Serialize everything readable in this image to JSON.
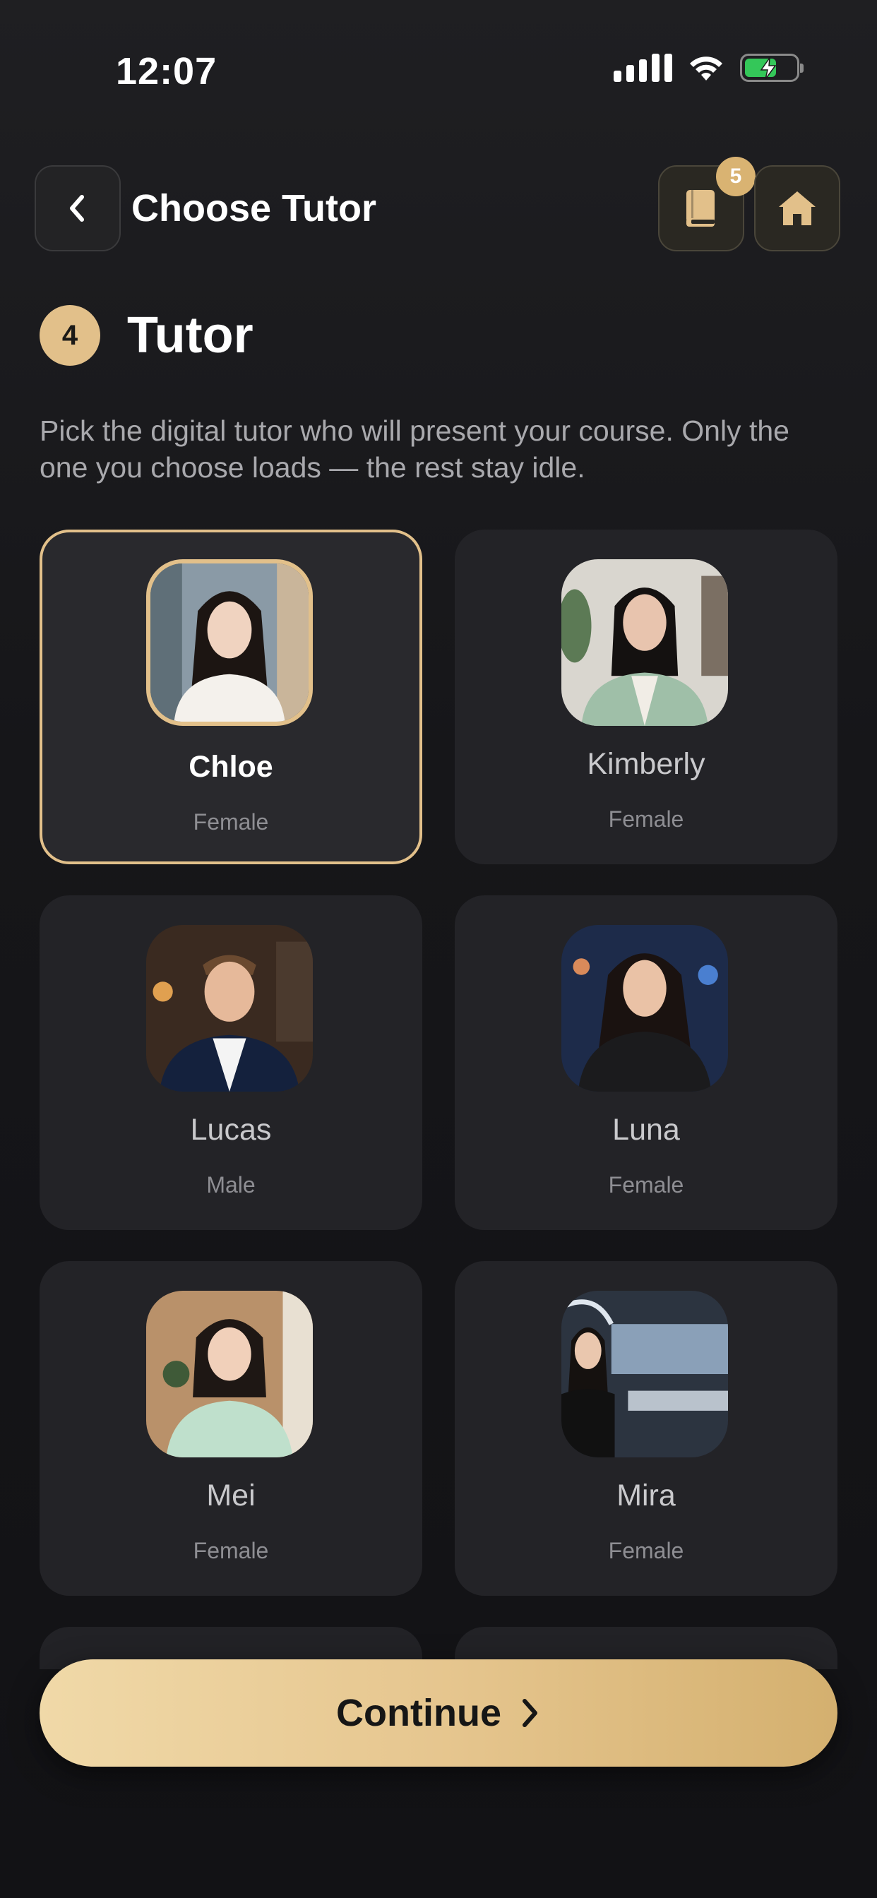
{
  "status_bar": {
    "time": "12:07",
    "icons": [
      "signal-icon",
      "wifi-icon",
      "battery-charging-icon"
    ]
  },
  "header": {
    "title": "Choose Tutor",
    "back_icon": "chevron-left-icon",
    "book_icon": "book-icon",
    "book_badge": "5",
    "home_icon": "home-icon"
  },
  "section": {
    "step": "4",
    "title": "Tutor",
    "description": "Pick the digital tutor who will present your course. Only the one you choose loads — the rest stay idle."
  },
  "tutors": [
    {
      "name": "Chloe",
      "gender": "Female",
      "selected": true
    },
    {
      "name": "Kimberly",
      "gender": "Female",
      "selected": false
    },
    {
      "name": "Lucas",
      "gender": "Male",
      "selected": false
    },
    {
      "name": "Luna",
      "gender": "Female",
      "selected": false
    },
    {
      "name": "Mei",
      "gender": "Female",
      "selected": false
    },
    {
      "name": "Mira",
      "gender": "Female",
      "selected": false
    }
  ],
  "continue_button": {
    "label": "Continue",
    "icon": "chevron-right-icon"
  },
  "colors": {
    "accent": "#e2c08a",
    "background": "#161619",
    "card": "#232327",
    "battery": "#34c759"
  }
}
